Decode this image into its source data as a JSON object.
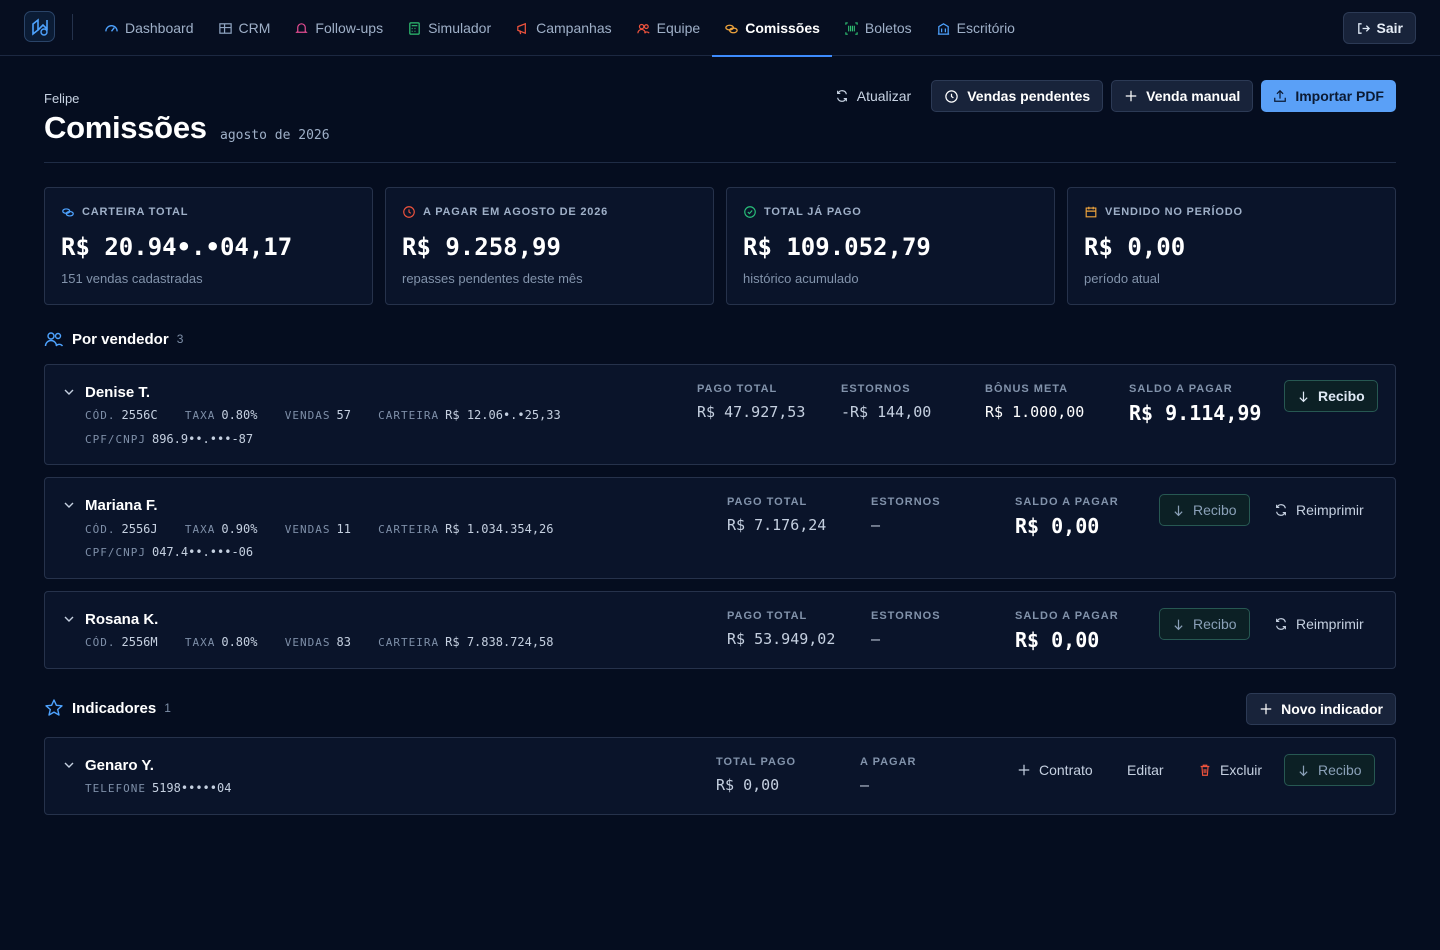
{
  "nav": {
    "items": [
      {
        "label": "Dashboard",
        "icon": "gauge-icon"
      },
      {
        "label": "CRM",
        "icon": "grid-icon"
      },
      {
        "label": "Follow-ups",
        "icon": "bell-icon"
      },
      {
        "label": "Simulador",
        "icon": "calculator-icon"
      },
      {
        "label": "Campanhas",
        "icon": "megaphone-icon"
      },
      {
        "label": "Equipe",
        "icon": "users-icon"
      },
      {
        "label": "Comissões",
        "icon": "coins-icon",
        "active": true
      },
      {
        "label": "Boletos",
        "icon": "barcode-icon"
      },
      {
        "label": "Escritório",
        "icon": "building-icon"
      }
    ],
    "logout_label": "Sair"
  },
  "header": {
    "user": "Felipe",
    "title": "Comissões",
    "period": "agosto de 2026",
    "actions": {
      "refresh": "Atualizar",
      "pending": "Vendas pendentes",
      "manual": "Venda manual",
      "import": "Importar PDF"
    }
  },
  "stats": [
    {
      "label": "CARTEIRA TOTAL",
      "value": "R$ 20.94•.•04,17",
      "sub": "151 vendas cadastradas",
      "icon": "coins-icon",
      "color": "#4ea3ff"
    },
    {
      "label": "A PAGAR EM AGOSTO DE 2026",
      "value": "R$ 9.258,99",
      "sub": "repasses pendentes deste mês",
      "icon": "clock-icon",
      "color": "#f0533d"
    },
    {
      "label": "TOTAL JÁ PAGO",
      "value": "R$ 109.052,79",
      "sub": "histórico acumulado",
      "icon": "check-circle-icon",
      "color": "#29c07a"
    },
    {
      "label": "VENDIDO NO PERÍODO",
      "value": "R$ 0,00",
      "sub": "período atual",
      "icon": "calendar-icon",
      "color": "#f0a53d"
    }
  ],
  "sellers_section": {
    "title": "Por vendedor",
    "count": "3"
  },
  "sellers": [
    {
      "name": "Denise T.",
      "cod_k": "CÓD.",
      "cod": "2556C",
      "taxa_k": "TAXA",
      "taxa": "0.80%",
      "vendas_k": "VENDAS",
      "vendas": "57",
      "carteira_k": "CARTEIRA",
      "carteira": "R$ 12.06•.•25,33",
      "cpf_k": "CPF/CNPJ",
      "cpf": "896.9••.•••-87",
      "pago_k": "PAGO TOTAL",
      "pago": "R$ 47.927,53",
      "estornos_k": "ESTORNOS",
      "estornos": "-R$ 144,00",
      "bonus_k": "BÔNUS META",
      "bonus": "R$ 1.000,00",
      "saldo_k": "SALDO A PAGAR",
      "saldo": "R$ 9.114,99",
      "recibo": "Recibo"
    },
    {
      "name": "Mariana F.",
      "cod_k": "CÓD.",
      "cod": "2556J",
      "taxa_k": "TAXA",
      "taxa": "0.90%",
      "vendas_k": "VENDAS",
      "vendas": "11",
      "carteira_k": "CARTEIRA",
      "carteira": "R$ 1.034.354,26",
      "cpf_k": "CPF/CNPJ",
      "cpf": "047.4••.•••-06",
      "pago_k": "PAGO TOTAL",
      "pago": "R$ 7.176,24",
      "estornos_k": "ESTORNOS",
      "estornos": "—",
      "saldo_k": "SALDO A PAGAR",
      "saldo": "R$ 0,00",
      "recibo": "Recibo",
      "reprint": "Reimprimir"
    },
    {
      "name": "Rosana K.",
      "cod_k": "CÓD.",
      "cod": "2556M",
      "taxa_k": "TAXA",
      "taxa": "0.80%",
      "vendas_k": "VENDAS",
      "vendas": "83",
      "carteira_k": "CARTEIRA",
      "carteira": "R$ 7.838.724,58",
      "pago_k": "PAGO TOTAL",
      "pago": "R$ 53.949,02",
      "estornos_k": "ESTORNOS",
      "estornos": "—",
      "saldo_k": "SALDO A PAGAR",
      "saldo": "R$ 0,00",
      "recibo": "Recibo",
      "reprint": "Reimprimir"
    }
  ],
  "indicators_section": {
    "title": "Indicadores",
    "count": "1",
    "new_label": "Novo indicador"
  },
  "indicators": [
    {
      "name": "Genaro Y.",
      "phone_k": "TELEFONE",
      "phone": "5198•••••04",
      "total_k": "TOTAL PAGO",
      "total": "R$ 0,00",
      "apagar_k": "A PAGAR",
      "apagar": "—",
      "contrato": "Contrato",
      "editar": "Editar",
      "excluir": "Excluir",
      "recibo": "Recibo"
    }
  ]
}
